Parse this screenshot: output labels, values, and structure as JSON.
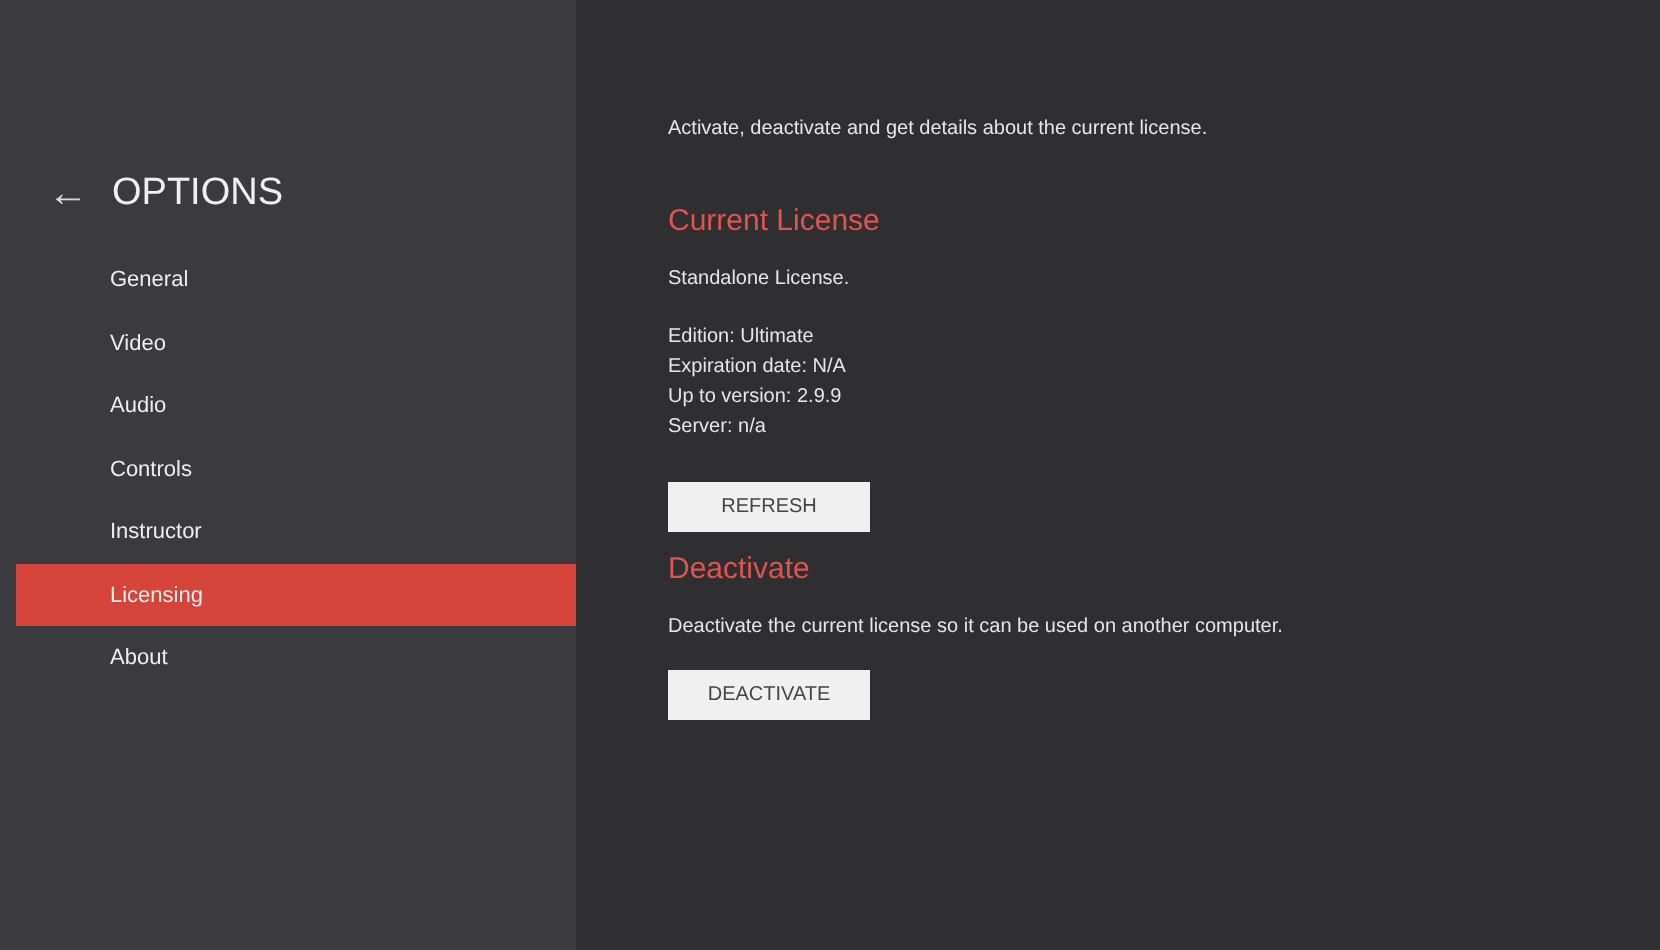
{
  "sidebar": {
    "back": "←",
    "title": "OPTIONS",
    "items": [
      {
        "label": "General",
        "selected": false
      },
      {
        "label": "Video",
        "selected": false
      },
      {
        "label": "Audio",
        "selected": false
      },
      {
        "label": "Controls",
        "selected": false
      },
      {
        "label": "Instructor",
        "selected": false
      },
      {
        "label": "Licensing",
        "selected": true
      },
      {
        "label": "About",
        "selected": false
      }
    ]
  },
  "content": {
    "intro": "Activate, deactivate and get details about the current license.",
    "sections": [
      {
        "heading": "Current License",
        "lines": [
          "Standalone License."
        ],
        "details": [
          "Edition: Ultimate",
          "Expiration date: N/A",
          "Up to version: 2.9.9",
          "Server: n/a"
        ],
        "button": "REFRESH"
      },
      {
        "heading": "Deactivate",
        "lines": [
          "Deactivate the current license so it can be used on another computer."
        ],
        "button": "DEACTIVATE"
      }
    ]
  }
}
